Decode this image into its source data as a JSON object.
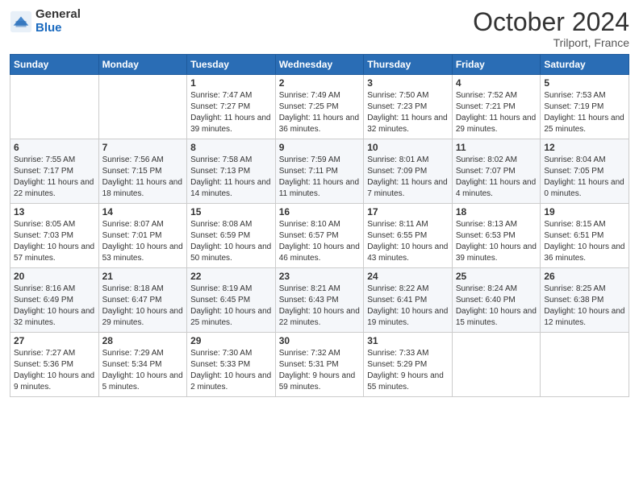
{
  "header": {
    "logo_general": "General",
    "logo_blue": "Blue",
    "month_title": "October 2024",
    "location": "Trilport, France"
  },
  "weekdays": [
    "Sunday",
    "Monday",
    "Tuesday",
    "Wednesday",
    "Thursday",
    "Friday",
    "Saturday"
  ],
  "weeks": [
    [
      {
        "day": "",
        "sunrise": "",
        "sunset": "",
        "daylight": ""
      },
      {
        "day": "",
        "sunrise": "",
        "sunset": "",
        "daylight": ""
      },
      {
        "day": "1",
        "sunrise": "Sunrise: 7:47 AM",
        "sunset": "Sunset: 7:27 PM",
        "daylight": "Daylight: 11 hours and 39 minutes."
      },
      {
        "day": "2",
        "sunrise": "Sunrise: 7:49 AM",
        "sunset": "Sunset: 7:25 PM",
        "daylight": "Daylight: 11 hours and 36 minutes."
      },
      {
        "day": "3",
        "sunrise": "Sunrise: 7:50 AM",
        "sunset": "Sunset: 7:23 PM",
        "daylight": "Daylight: 11 hours and 32 minutes."
      },
      {
        "day": "4",
        "sunrise": "Sunrise: 7:52 AM",
        "sunset": "Sunset: 7:21 PM",
        "daylight": "Daylight: 11 hours and 29 minutes."
      },
      {
        "day": "5",
        "sunrise": "Sunrise: 7:53 AM",
        "sunset": "Sunset: 7:19 PM",
        "daylight": "Daylight: 11 hours and 25 minutes."
      }
    ],
    [
      {
        "day": "6",
        "sunrise": "Sunrise: 7:55 AM",
        "sunset": "Sunset: 7:17 PM",
        "daylight": "Daylight: 11 hours and 22 minutes."
      },
      {
        "day": "7",
        "sunrise": "Sunrise: 7:56 AM",
        "sunset": "Sunset: 7:15 PM",
        "daylight": "Daylight: 11 hours and 18 minutes."
      },
      {
        "day": "8",
        "sunrise": "Sunrise: 7:58 AM",
        "sunset": "Sunset: 7:13 PM",
        "daylight": "Daylight: 11 hours and 14 minutes."
      },
      {
        "day": "9",
        "sunrise": "Sunrise: 7:59 AM",
        "sunset": "Sunset: 7:11 PM",
        "daylight": "Daylight: 11 hours and 11 minutes."
      },
      {
        "day": "10",
        "sunrise": "Sunrise: 8:01 AM",
        "sunset": "Sunset: 7:09 PM",
        "daylight": "Daylight: 11 hours and 7 minutes."
      },
      {
        "day": "11",
        "sunrise": "Sunrise: 8:02 AM",
        "sunset": "Sunset: 7:07 PM",
        "daylight": "Daylight: 11 hours and 4 minutes."
      },
      {
        "day": "12",
        "sunrise": "Sunrise: 8:04 AM",
        "sunset": "Sunset: 7:05 PM",
        "daylight": "Daylight: 11 hours and 0 minutes."
      }
    ],
    [
      {
        "day": "13",
        "sunrise": "Sunrise: 8:05 AM",
        "sunset": "Sunset: 7:03 PM",
        "daylight": "Daylight: 10 hours and 57 minutes."
      },
      {
        "day": "14",
        "sunrise": "Sunrise: 8:07 AM",
        "sunset": "Sunset: 7:01 PM",
        "daylight": "Daylight: 10 hours and 53 minutes."
      },
      {
        "day": "15",
        "sunrise": "Sunrise: 8:08 AM",
        "sunset": "Sunset: 6:59 PM",
        "daylight": "Daylight: 10 hours and 50 minutes."
      },
      {
        "day": "16",
        "sunrise": "Sunrise: 8:10 AM",
        "sunset": "Sunset: 6:57 PM",
        "daylight": "Daylight: 10 hours and 46 minutes."
      },
      {
        "day": "17",
        "sunrise": "Sunrise: 8:11 AM",
        "sunset": "Sunset: 6:55 PM",
        "daylight": "Daylight: 10 hours and 43 minutes."
      },
      {
        "day": "18",
        "sunrise": "Sunrise: 8:13 AM",
        "sunset": "Sunset: 6:53 PM",
        "daylight": "Daylight: 10 hours and 39 minutes."
      },
      {
        "day": "19",
        "sunrise": "Sunrise: 8:15 AM",
        "sunset": "Sunset: 6:51 PM",
        "daylight": "Daylight: 10 hours and 36 minutes."
      }
    ],
    [
      {
        "day": "20",
        "sunrise": "Sunrise: 8:16 AM",
        "sunset": "Sunset: 6:49 PM",
        "daylight": "Daylight: 10 hours and 32 minutes."
      },
      {
        "day": "21",
        "sunrise": "Sunrise: 8:18 AM",
        "sunset": "Sunset: 6:47 PM",
        "daylight": "Daylight: 10 hours and 29 minutes."
      },
      {
        "day": "22",
        "sunrise": "Sunrise: 8:19 AM",
        "sunset": "Sunset: 6:45 PM",
        "daylight": "Daylight: 10 hours and 25 minutes."
      },
      {
        "day": "23",
        "sunrise": "Sunrise: 8:21 AM",
        "sunset": "Sunset: 6:43 PM",
        "daylight": "Daylight: 10 hours and 22 minutes."
      },
      {
        "day": "24",
        "sunrise": "Sunrise: 8:22 AM",
        "sunset": "Sunset: 6:41 PM",
        "daylight": "Daylight: 10 hours and 19 minutes."
      },
      {
        "day": "25",
        "sunrise": "Sunrise: 8:24 AM",
        "sunset": "Sunset: 6:40 PM",
        "daylight": "Daylight: 10 hours and 15 minutes."
      },
      {
        "day": "26",
        "sunrise": "Sunrise: 8:25 AM",
        "sunset": "Sunset: 6:38 PM",
        "daylight": "Daylight: 10 hours and 12 minutes."
      }
    ],
    [
      {
        "day": "27",
        "sunrise": "Sunrise: 7:27 AM",
        "sunset": "Sunset: 5:36 PM",
        "daylight": "Daylight: 10 hours and 9 minutes."
      },
      {
        "day": "28",
        "sunrise": "Sunrise: 7:29 AM",
        "sunset": "Sunset: 5:34 PM",
        "daylight": "Daylight: 10 hours and 5 minutes."
      },
      {
        "day": "29",
        "sunrise": "Sunrise: 7:30 AM",
        "sunset": "Sunset: 5:33 PM",
        "daylight": "Daylight: 10 hours and 2 minutes."
      },
      {
        "day": "30",
        "sunrise": "Sunrise: 7:32 AM",
        "sunset": "Sunset: 5:31 PM",
        "daylight": "Daylight: 9 hours and 59 minutes."
      },
      {
        "day": "31",
        "sunrise": "Sunrise: 7:33 AM",
        "sunset": "Sunset: 5:29 PM",
        "daylight": "Daylight: 9 hours and 55 minutes."
      },
      {
        "day": "",
        "sunrise": "",
        "sunset": "",
        "daylight": ""
      },
      {
        "day": "",
        "sunrise": "",
        "sunset": "",
        "daylight": ""
      }
    ]
  ]
}
